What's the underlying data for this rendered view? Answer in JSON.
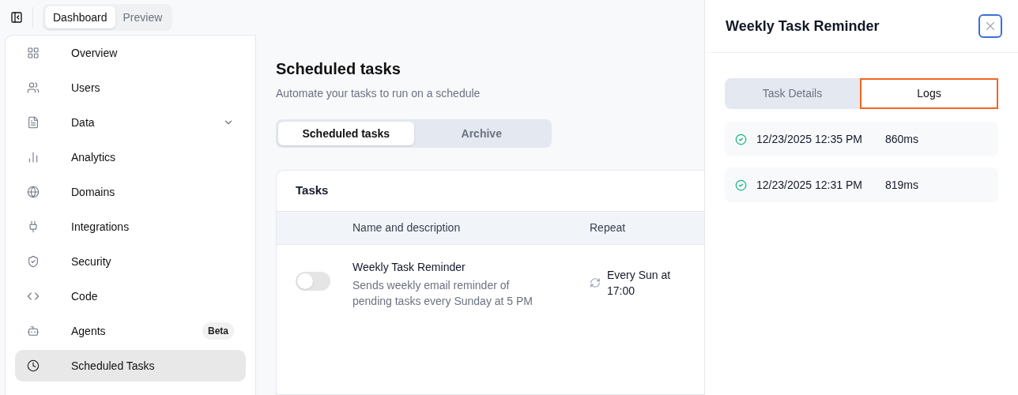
{
  "topbar": {
    "views": [
      {
        "label": "Dashboard",
        "selected": true
      },
      {
        "label": "Preview",
        "selected": false
      }
    ]
  },
  "sidebar": {
    "items": [
      {
        "label": "Overview",
        "kind": "link",
        "selected": false
      },
      {
        "label": "Users",
        "kind": "link",
        "selected": false
      },
      {
        "label": "Data",
        "kind": "group",
        "expanded": false,
        "selected": false
      },
      {
        "label": "Analytics",
        "kind": "link",
        "selected": false
      },
      {
        "label": "Domains",
        "kind": "link",
        "selected": false
      },
      {
        "label": "Integrations",
        "kind": "link",
        "selected": false
      },
      {
        "label": "Security",
        "kind": "link",
        "selected": false
      },
      {
        "label": "Code",
        "kind": "link",
        "selected": false
      },
      {
        "label": "Agents",
        "kind": "link",
        "badge": "Beta",
        "selected": false
      },
      {
        "label": "Scheduled Tasks",
        "kind": "link",
        "selected": true
      }
    ]
  },
  "main": {
    "title": "Scheduled tasks",
    "subtitle": "Automate your tasks to run on a schedule",
    "tabs": [
      {
        "label": "Scheduled tasks",
        "selected": true
      },
      {
        "label": "Archive",
        "selected": false
      }
    ],
    "card_title": "Tasks",
    "table": {
      "columns": [
        "Name and description",
        "Repeat"
      ],
      "rows": [
        {
          "on": false,
          "name": "Weekly Task Reminder",
          "description": "Sends weekly email reminder of pending tasks every Sunday at 5 PM",
          "repeat": "Every Sun at 17:00"
        }
      ]
    }
  },
  "drawer": {
    "title": "Weekly Task Reminder",
    "tabs": [
      {
        "label": "Task Details",
        "selected": false
      },
      {
        "label": "Logs",
        "selected": true
      }
    ],
    "logs": [
      {
        "succeeded": true,
        "time": "12/23/2025 12:35 PM",
        "duration": "860ms"
      },
      {
        "succeeded": true,
        "time": "12/23/2025 12:31 PM",
        "duration": "819ms"
      }
    ]
  }
}
